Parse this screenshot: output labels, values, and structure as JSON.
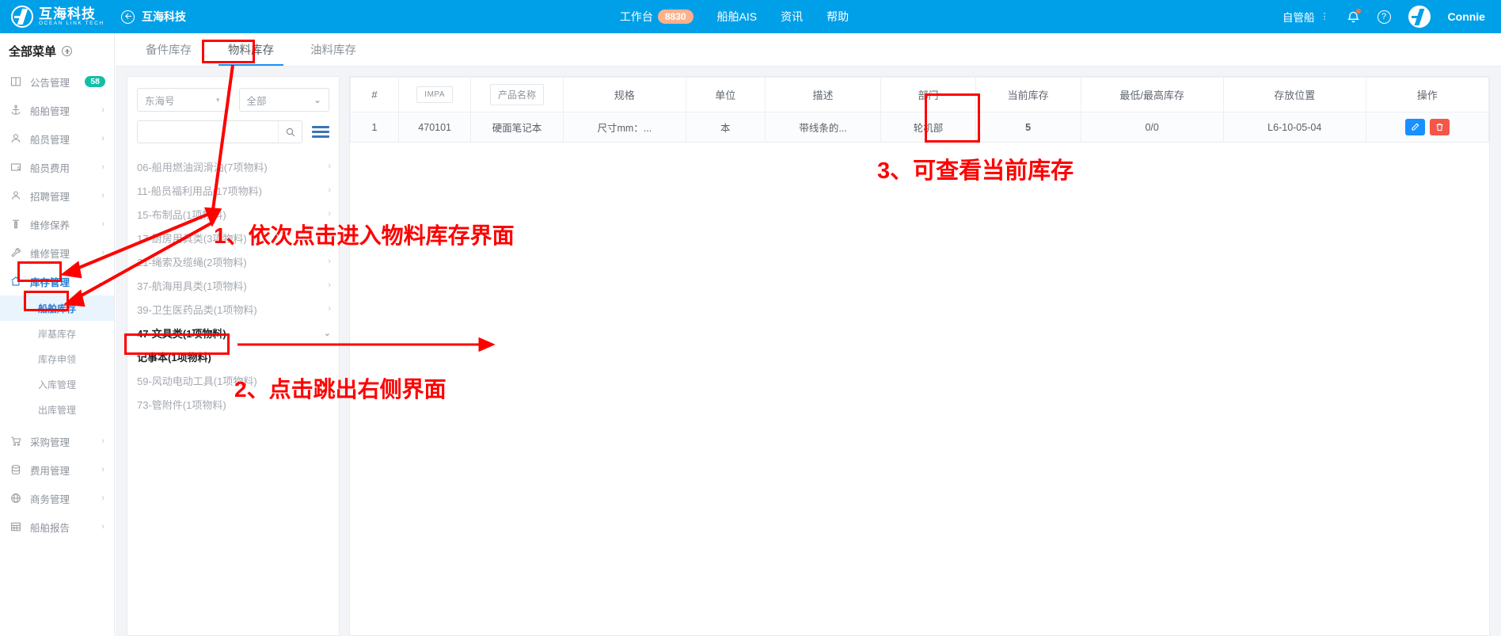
{
  "topbar": {
    "brand_cn": "互海科技",
    "brand_en": "OCEAN LINK TECH",
    "back_label": "互海科技",
    "nav": [
      {
        "label": "工作台",
        "badge": "8830"
      },
      {
        "label": "船舶AIS",
        "badge": ""
      },
      {
        "label": "资讯",
        "badge": ""
      },
      {
        "label": "帮助",
        "badge": ""
      }
    ],
    "fleet_selector": "自管船",
    "username": "Connie",
    "icons": {
      "bell": "bell-icon",
      "help": "help-circle-icon",
      "avatar": "avatar-icon"
    }
  },
  "sidebar": {
    "title": "全部菜单",
    "items": [
      {
        "label": "公告管理",
        "icon": "announcement-icon",
        "badge": "58",
        "chevron": false
      },
      {
        "label": "船舶管理",
        "icon": "anchor-icon",
        "badge": "",
        "chevron": true
      },
      {
        "label": "船员管理",
        "icon": "crew-icon",
        "badge": "",
        "chevron": true
      },
      {
        "label": "船员费用",
        "icon": "cost-card-icon",
        "badge": "",
        "chevron": true
      },
      {
        "label": "招聘管理",
        "icon": "recruit-icon",
        "badge": "",
        "chevron": true
      },
      {
        "label": "维修保养",
        "icon": "maintain-icon",
        "badge": "",
        "chevron": true
      },
      {
        "label": "维修管理",
        "icon": "wrench-icon",
        "badge": "",
        "chevron": true
      },
      {
        "label": "库存管理",
        "icon": "home-icon",
        "badge": "",
        "chevron": true,
        "active": true,
        "expanded": true
      }
    ],
    "submenu": [
      {
        "label": "船舶库存",
        "selected": true
      },
      {
        "label": "岸基库存",
        "selected": false
      },
      {
        "label": "库存申领",
        "selected": false
      },
      {
        "label": "入库管理",
        "selected": false
      },
      {
        "label": "出库管理",
        "selected": false
      }
    ],
    "items_after": [
      {
        "label": "采购管理",
        "icon": "cart-icon",
        "chevron": true
      },
      {
        "label": "费用管理",
        "icon": "database-icon",
        "chevron": true
      },
      {
        "label": "商务管理",
        "icon": "globe-icon",
        "chevron": true
      },
      {
        "label": "船舶报告",
        "icon": "report-icon",
        "chevron": true
      }
    ]
  },
  "tabs": [
    {
      "label": "备件库存",
      "active": false
    },
    {
      "label": "物料库存",
      "active": true
    },
    {
      "label": "油料库存",
      "active": false
    }
  ],
  "left_panel": {
    "vessel_select": "东海号",
    "dept_select": "全部",
    "search_value": "",
    "search_placeholder": "",
    "search_icon": "search-icon",
    "menu_icon": "list-menu-icon",
    "categories": [
      {
        "label": "06-船用燃油润滑油(7项物料)",
        "arrow": "›",
        "expanded": false,
        "child": false
      },
      {
        "label": "11-船员福利用品(17项物料)",
        "arrow": "›",
        "expanded": false,
        "child": false
      },
      {
        "label": "15-布制品(1项物料)",
        "arrow": "›",
        "expanded": false,
        "child": false
      },
      {
        "label": "17-厨房用具类(3项物料)",
        "arrow": "›",
        "expanded": false,
        "child": false
      },
      {
        "label": "21-绳索及缆绳(2项物料)",
        "arrow": "›",
        "expanded": false,
        "child": false
      },
      {
        "label": "37-航海用具类(1项物料)",
        "arrow": "›",
        "expanded": false,
        "child": false
      },
      {
        "label": "39-卫生医药品类(1项物料)",
        "arrow": "›",
        "expanded": false,
        "child": false
      },
      {
        "label": "47-文具类(1项物料)",
        "arrow": "⌄",
        "expanded": true,
        "child": false
      },
      {
        "label": "记事本(1项物料)",
        "arrow": "",
        "expanded": false,
        "child": true
      },
      {
        "label": "59-风动电动工具(1项物料)",
        "arrow": "",
        "expanded": false,
        "child": false
      },
      {
        "label": "73-管附件(1项物料)",
        "arrow": "",
        "expanded": false,
        "child": false
      }
    ]
  },
  "table": {
    "headers": [
      {
        "label": "#",
        "boxed": false
      },
      {
        "label": "IMPA",
        "boxed": true,
        "small": true
      },
      {
        "label": "产品名称",
        "boxed": true
      },
      {
        "label": "规格",
        "boxed": false
      },
      {
        "label": "单位",
        "boxed": false
      },
      {
        "label": "描述",
        "boxed": false
      },
      {
        "label": "部门",
        "boxed": false
      },
      {
        "label": "当前库存",
        "boxed": false
      },
      {
        "label": "最低/最高库存",
        "boxed": false
      },
      {
        "label": "存放位置",
        "boxed": false
      },
      {
        "label": "操作",
        "boxed": false
      }
    ],
    "rows": [
      {
        "index": "1",
        "impa": "470101",
        "name": "硬面笔记本",
        "spec": "尺寸mm：...",
        "unit": "本",
        "desc": "带线条的...",
        "dept": "轮机部",
        "stock": "5",
        "minmax": "0/0",
        "location": "L6-10-05-04",
        "actions": [
          {
            "icon": "edit-icon",
            "glyph": "✎",
            "style": "edit"
          },
          {
            "icon": "delete-icon",
            "glyph": "🗑",
            "style": "del"
          }
        ]
      }
    ]
  },
  "annotations": {
    "step1": "1、依次点击进入物料库存界面",
    "step2": "2、点击跳出右侧界面",
    "step3": "3、可查看当前库存",
    "color": "#ff0000"
  }
}
